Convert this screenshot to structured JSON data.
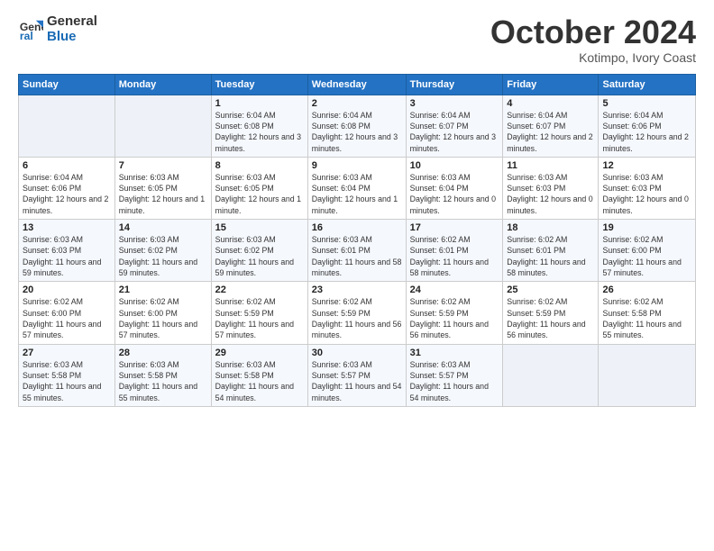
{
  "header": {
    "logo_line1": "General",
    "logo_line2": "Blue",
    "month": "October 2024",
    "location": "Kotimpo, Ivory Coast"
  },
  "weekdays": [
    "Sunday",
    "Monday",
    "Tuesday",
    "Wednesday",
    "Thursday",
    "Friday",
    "Saturday"
  ],
  "weeks": [
    [
      {
        "day": "",
        "info": ""
      },
      {
        "day": "",
        "info": ""
      },
      {
        "day": "1",
        "info": "Sunrise: 6:04 AM\nSunset: 6:08 PM\nDaylight: 12 hours and 3 minutes."
      },
      {
        "day": "2",
        "info": "Sunrise: 6:04 AM\nSunset: 6:08 PM\nDaylight: 12 hours and 3 minutes."
      },
      {
        "day": "3",
        "info": "Sunrise: 6:04 AM\nSunset: 6:07 PM\nDaylight: 12 hours and 3 minutes."
      },
      {
        "day": "4",
        "info": "Sunrise: 6:04 AM\nSunset: 6:07 PM\nDaylight: 12 hours and 2 minutes."
      },
      {
        "day": "5",
        "info": "Sunrise: 6:04 AM\nSunset: 6:06 PM\nDaylight: 12 hours and 2 minutes."
      }
    ],
    [
      {
        "day": "6",
        "info": "Sunrise: 6:04 AM\nSunset: 6:06 PM\nDaylight: 12 hours and 2 minutes."
      },
      {
        "day": "7",
        "info": "Sunrise: 6:03 AM\nSunset: 6:05 PM\nDaylight: 12 hours and 1 minute."
      },
      {
        "day": "8",
        "info": "Sunrise: 6:03 AM\nSunset: 6:05 PM\nDaylight: 12 hours and 1 minute."
      },
      {
        "day": "9",
        "info": "Sunrise: 6:03 AM\nSunset: 6:04 PM\nDaylight: 12 hours and 1 minute."
      },
      {
        "day": "10",
        "info": "Sunrise: 6:03 AM\nSunset: 6:04 PM\nDaylight: 12 hours and 0 minutes."
      },
      {
        "day": "11",
        "info": "Sunrise: 6:03 AM\nSunset: 6:03 PM\nDaylight: 12 hours and 0 minutes."
      },
      {
        "day": "12",
        "info": "Sunrise: 6:03 AM\nSunset: 6:03 PM\nDaylight: 12 hours and 0 minutes."
      }
    ],
    [
      {
        "day": "13",
        "info": "Sunrise: 6:03 AM\nSunset: 6:03 PM\nDaylight: 11 hours and 59 minutes."
      },
      {
        "day": "14",
        "info": "Sunrise: 6:03 AM\nSunset: 6:02 PM\nDaylight: 11 hours and 59 minutes."
      },
      {
        "day": "15",
        "info": "Sunrise: 6:03 AM\nSunset: 6:02 PM\nDaylight: 11 hours and 59 minutes."
      },
      {
        "day": "16",
        "info": "Sunrise: 6:03 AM\nSunset: 6:01 PM\nDaylight: 11 hours and 58 minutes."
      },
      {
        "day": "17",
        "info": "Sunrise: 6:02 AM\nSunset: 6:01 PM\nDaylight: 11 hours and 58 minutes."
      },
      {
        "day": "18",
        "info": "Sunrise: 6:02 AM\nSunset: 6:01 PM\nDaylight: 11 hours and 58 minutes."
      },
      {
        "day": "19",
        "info": "Sunrise: 6:02 AM\nSunset: 6:00 PM\nDaylight: 11 hours and 57 minutes."
      }
    ],
    [
      {
        "day": "20",
        "info": "Sunrise: 6:02 AM\nSunset: 6:00 PM\nDaylight: 11 hours and 57 minutes."
      },
      {
        "day": "21",
        "info": "Sunrise: 6:02 AM\nSunset: 6:00 PM\nDaylight: 11 hours and 57 minutes."
      },
      {
        "day": "22",
        "info": "Sunrise: 6:02 AM\nSunset: 5:59 PM\nDaylight: 11 hours and 57 minutes."
      },
      {
        "day": "23",
        "info": "Sunrise: 6:02 AM\nSunset: 5:59 PM\nDaylight: 11 hours and 56 minutes."
      },
      {
        "day": "24",
        "info": "Sunrise: 6:02 AM\nSunset: 5:59 PM\nDaylight: 11 hours and 56 minutes."
      },
      {
        "day": "25",
        "info": "Sunrise: 6:02 AM\nSunset: 5:59 PM\nDaylight: 11 hours and 56 minutes."
      },
      {
        "day": "26",
        "info": "Sunrise: 6:02 AM\nSunset: 5:58 PM\nDaylight: 11 hours and 55 minutes."
      }
    ],
    [
      {
        "day": "27",
        "info": "Sunrise: 6:03 AM\nSunset: 5:58 PM\nDaylight: 11 hours and 55 minutes."
      },
      {
        "day": "28",
        "info": "Sunrise: 6:03 AM\nSunset: 5:58 PM\nDaylight: 11 hours and 55 minutes."
      },
      {
        "day": "29",
        "info": "Sunrise: 6:03 AM\nSunset: 5:58 PM\nDaylight: 11 hours and 54 minutes."
      },
      {
        "day": "30",
        "info": "Sunrise: 6:03 AM\nSunset: 5:57 PM\nDaylight: 11 hours and 54 minutes."
      },
      {
        "day": "31",
        "info": "Sunrise: 6:03 AM\nSunset: 5:57 PM\nDaylight: 11 hours and 54 minutes."
      },
      {
        "day": "",
        "info": ""
      },
      {
        "day": "",
        "info": ""
      }
    ]
  ]
}
